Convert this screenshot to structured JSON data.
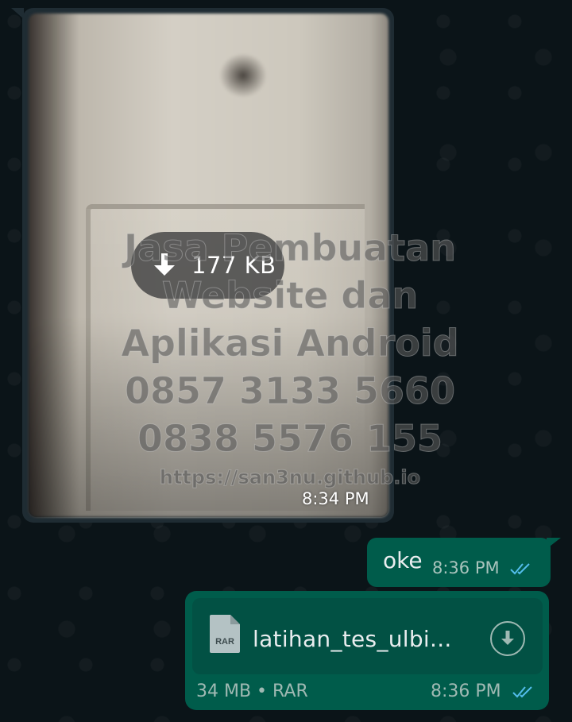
{
  "incoming_image": {
    "download_size": "177 KB",
    "time": "8:34 PM",
    "watermark": [
      "Jasa Pembuatan",
      "Website dan",
      "Aplikasi Android",
      "0857 3133 5660",
      "0838 5576 155"
    ],
    "watermark_url": "https://san3nu.github.io"
  },
  "outgoing_text": {
    "message": "oke",
    "time": "8:36 PM",
    "status_icon": "double-check-icon"
  },
  "outgoing_file": {
    "file_type_badge": "RAR",
    "file_name": "latihan_tes_ulbi...",
    "meta": "34 MB • RAR",
    "time": "8:36 PM",
    "status_icon": "double-check-icon"
  },
  "colors": {
    "background": "#0b1418",
    "incoming_bubble": "#1f2c33",
    "outgoing_bubble": "#005c4b",
    "read_check": "#53bdeb"
  }
}
